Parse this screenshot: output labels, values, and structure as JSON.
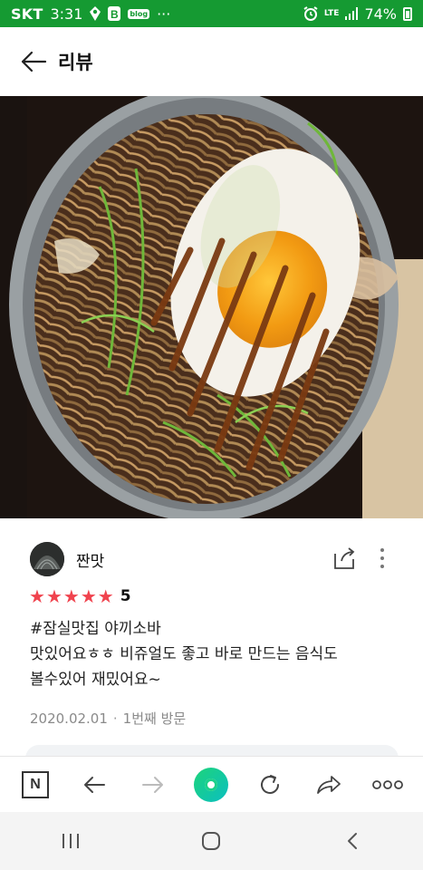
{
  "status_bar": {
    "carrier": "SKT",
    "time": "3:31",
    "blog_badge": "blog",
    "overflow": "···",
    "network": "LTE",
    "battery": "74%",
    "icons": [
      "location-icon",
      "b-app-icon",
      "blog-icon",
      "alarm-icon",
      "lte-icon",
      "signal-icon",
      "battery-icon"
    ]
  },
  "header": {
    "title": "리뷰",
    "back_icon": "arrow-left-icon"
  },
  "photo": {
    "subject": "food-photo-yakisoba"
  },
  "review": {
    "author": "짠맛",
    "rating": "5",
    "stars": 5,
    "lines": [
      "#잠실맛집 야끼소바",
      "맛있어요ㅎㅎ 비쥬얼도 좋고 바로 만드는 음식도",
      "볼수있어 재밌어요~"
    ],
    "date": "2020.02.01",
    "separator": "·",
    "visit": "1번째 방문",
    "share_icon": "share-icon",
    "more_icon": "more-vertical-icon"
  },
  "toolbar": {
    "naver_label": "N",
    "icons": [
      "naver-home-icon",
      "back-arrow-icon",
      "forward-arrow-icon",
      "green-dot-icon",
      "refresh-icon",
      "share-arrow-icon",
      "more-horizontal-icon"
    ]
  },
  "android_nav": {
    "icons": [
      "recent-apps-icon",
      "home-icon",
      "back-icon"
    ]
  },
  "colors": {
    "status_bar": "#159a32",
    "star": "#f0434e",
    "accent_green": "#1dd47a",
    "meta_text": "#8a8a8a"
  }
}
